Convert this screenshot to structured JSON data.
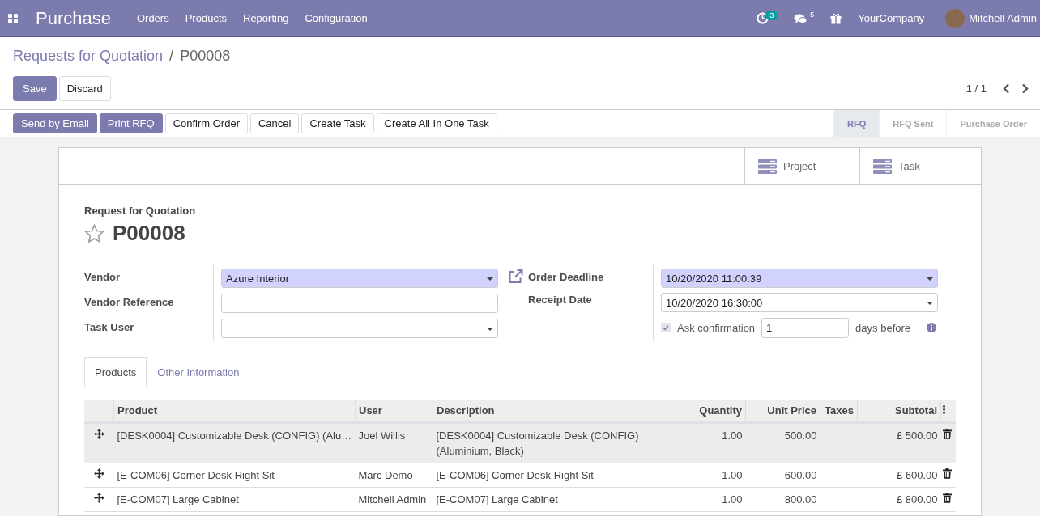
{
  "navbar": {
    "app_name": "Purchase",
    "menu": [
      "Orders",
      "Products",
      "Reporting",
      "Configuration"
    ],
    "activity_count": "3",
    "message_count": "5",
    "company": "YourCompany",
    "user": "Mitchell Admin"
  },
  "breadcrumb": {
    "parent": "Requests for Quotation",
    "separator": "/",
    "current": "P00008"
  },
  "control_buttons": [
    {
      "label": "Save",
      "primary": true
    },
    {
      "label": "Discard",
      "primary": false
    }
  ],
  "pager": {
    "value": "1 / 1"
  },
  "header_buttons": [
    {
      "label": "Send by Email",
      "primary": true
    },
    {
      "label": "Print RFQ",
      "primary": true
    },
    {
      "label": "Confirm Order",
      "primary": false
    },
    {
      "label": "Cancel",
      "primary": false
    },
    {
      "label": "Create Task",
      "primary": false
    },
    {
      "label": "Create All In One Task",
      "primary": false
    }
  ],
  "status_steps": [
    {
      "label": "RFQ",
      "selected": true
    },
    {
      "label": "RFQ Sent",
      "selected": false
    },
    {
      "label": "Purchase Order",
      "selected": false
    }
  ],
  "smart_buttons": [
    {
      "label": "Project"
    },
    {
      "label": "Task"
    }
  ],
  "form": {
    "subtitle": "Request for Quotation",
    "name": "P00008",
    "starred": false,
    "left_fields": [
      {
        "label": "Vendor",
        "value": "Azure Interior",
        "kind": "select",
        "required": true
      },
      {
        "label": "Vendor Reference",
        "kind": "text",
        "required": false
      },
      {
        "label": "Task User",
        "kind": "select",
        "required": false
      }
    ],
    "right_fields": [
      {
        "label": "Order Deadline",
        "value": "10/20/2020 11:00:39",
        "kind": "select",
        "required": true,
        "link_icon": true
      },
      {
        "label": "Receipt Date",
        "value": "10/20/2020 16:30:00",
        "kind": "select",
        "required": false,
        "link_icon": false
      }
    ],
    "ask_confirmation": {
      "label": "Ask confirmation",
      "checked": true,
      "value": "1",
      "suffix": "days before"
    }
  },
  "tabs": [
    {
      "label": "Products",
      "selected": true
    },
    {
      "label": "Other Information",
      "selected": false
    }
  ],
  "table": {
    "columns": [
      "Product",
      "User",
      "Description",
      "Quantity",
      "Unit Price",
      "Taxes",
      "Subtotal"
    ],
    "rows": [
      {
        "product": "[DESK0004] Customizable Desk (CONFIG) (Alu…",
        "user": "Joel Willis",
        "description": "[DESK0004] Customizable Desk (CONFIG) (Aluminium, Black)",
        "quantity": "1.00",
        "unit_price": "500.00",
        "subtotal": "£ 500.00",
        "selected": true
      },
      {
        "product": "[E-COM06] Corner Desk Right Sit",
        "user": "Marc Demo",
        "description": "[E-COM06] Corner Desk Right Sit",
        "quantity": "1.00",
        "unit_price": "600.00",
        "subtotal": "£ 600.00",
        "selected": false
      },
      {
        "product": "[E-COM07] Large Cabinet",
        "user": "Mitchell Admin",
        "description": "[E-COM07] Large Cabinet",
        "quantity": "1.00",
        "unit_price": "800.00",
        "subtotal": "£ 800.00",
        "selected": false
      }
    ]
  }
}
